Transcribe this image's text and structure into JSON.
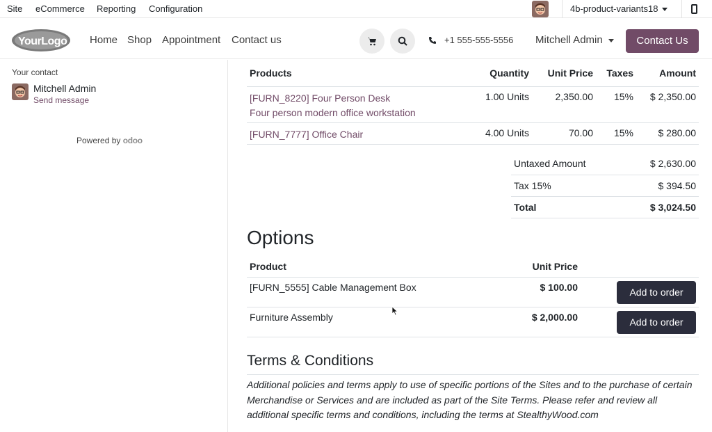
{
  "adminbar": {
    "menus": [
      "Site",
      "eCommerce",
      "Reporting",
      "Configuration"
    ],
    "database": "4b-product-variants18"
  },
  "header": {
    "logo_text": "YourLogo",
    "nav": [
      "Home",
      "Shop",
      "Appointment",
      "Contact us"
    ],
    "phone": "+1 555-555-5556",
    "user": "Mitchell Admin",
    "contact_button": "Contact Us",
    "brand_color": "#714b67"
  },
  "sidebar": {
    "your_contact": "Your contact",
    "contact_name": "Mitchell Admin",
    "send_message": "Send message",
    "powered_by": "Powered by",
    "powered_brand": "odoo"
  },
  "products": {
    "headers": [
      "Products",
      "Quantity",
      "Unit Price",
      "Taxes",
      "Amount"
    ],
    "rows": [
      {
        "name": "[FURN_8220] Four Person Desk",
        "description": "Four person modern office workstation",
        "quantity": "1.00 Units",
        "unit_price": "2,350.00",
        "taxes": "15%",
        "amount": "$ 2,350.00"
      },
      {
        "name": "[FURN_7777] Office Chair",
        "description": "",
        "quantity": "4.00 Units",
        "unit_price": "70.00",
        "taxes": "15%",
        "amount": "$ 280.00"
      }
    ]
  },
  "totals": {
    "untaxed_label": "Untaxed Amount",
    "untaxed_value": "$ 2,630.00",
    "tax_label": "Tax 15%",
    "tax_value": "$ 394.50",
    "total_label": "Total",
    "total_value": "$ 3,024.50"
  },
  "options": {
    "title": "Options",
    "headers": [
      "Product",
      "Unit Price"
    ],
    "rows": [
      {
        "name": "[FURN_5555] Cable Management Box",
        "price": "$ 100.00",
        "button": "Add to order"
      },
      {
        "name": "Furniture Assembly",
        "price": "$ 2,000.00",
        "button": "Add to order"
      }
    ]
  },
  "terms": {
    "title": "Terms & Conditions",
    "text": "Additional policies and terms apply to use of specific portions of the Sites and to the purchase of certain Merchandise or Services and are included as part of the Site Terms. Please refer and review all additional specific terms and conditions, including the terms at StealthyWood.com"
  }
}
